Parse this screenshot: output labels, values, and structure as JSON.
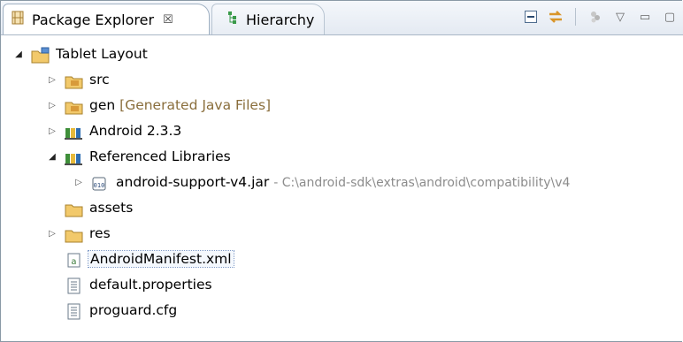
{
  "tabs": {
    "package_explorer": {
      "label": "Package Explorer",
      "close": "☒"
    },
    "hierarchy": {
      "label": "Hierarchy"
    }
  },
  "toolbar": {
    "collapse_all": "⊟",
    "link_with_editor": "⇆",
    "focus": "⁘",
    "view_menu": "▽",
    "minimize": "▭",
    "maximize": "▢"
  },
  "tree": {
    "project": {
      "label": "Tablet Layout",
      "twisty": "◢"
    },
    "src": {
      "label": "src",
      "twisty": "▷"
    },
    "gen": {
      "label": "gen",
      "decoration": "[Generated Java Files]",
      "twisty": "▷"
    },
    "android": {
      "label": "Android 2.3.3",
      "twisty": "▷"
    },
    "ref_libs": {
      "label": "Referenced Libraries",
      "twisty": "◢"
    },
    "jar": {
      "label": "android-support-v4.jar",
      "path": "- C:\\android-sdk\\extras\\android\\compatibility\\v4",
      "twisty": "▷"
    },
    "assets": {
      "label": "assets"
    },
    "res": {
      "label": "res",
      "twisty": "▷"
    },
    "manifest": {
      "label": "AndroidManifest.xml"
    },
    "default_props": {
      "label": "default.properties"
    },
    "proguard": {
      "label": "proguard.cfg"
    }
  },
  "colors": {
    "tab_bg": "#e4eaf2",
    "folder": "#f2c96b",
    "decoration": "#8a6e3c",
    "path_gray": "#8c8c8c"
  }
}
